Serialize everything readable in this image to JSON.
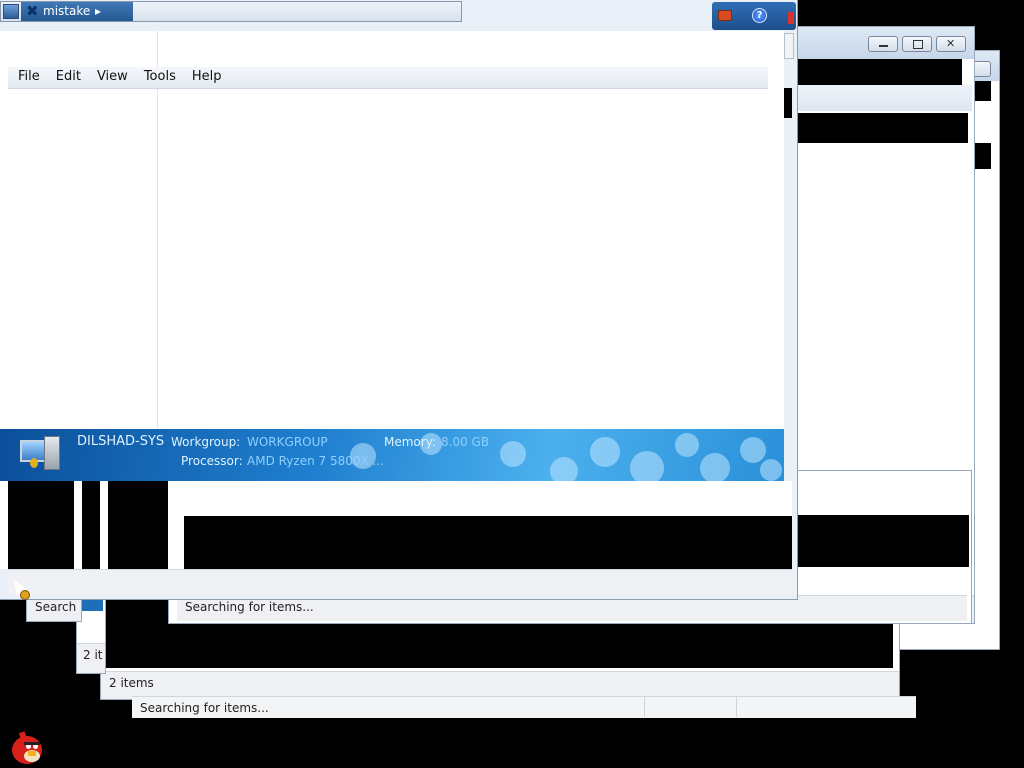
{
  "top_window": {
    "address_bar": {
      "app_icon": "control-panel-icon",
      "crumb_icon": "x-mark-icon",
      "crumb_label": "mistake",
      "chevron": "▸"
    },
    "menu": [
      "File",
      "Edit",
      "View",
      "Tools",
      "Help"
    ],
    "help_glyph": "?",
    "system_info": {
      "computer_name": "DILSHAD-SYS",
      "workgroup_label": "Workgroup:",
      "workgroup_value": "WORKGROUP",
      "memory_label": "Memory:",
      "memory_value": "8.00 GB",
      "processor_label": "Processor:",
      "processor_value": "AMD Ryzen 7 5800X ..."
    }
  },
  "background_windows": {
    "status_search_full": "Searching for items...",
    "status_search_cut": "Search",
    "status_items": "2 items",
    "status_items_cut": "2 it",
    "status_search_bottom": "Searching for items..."
  },
  "desktop": {
    "icon": "angry-bird-icon"
  },
  "colors": {
    "accent": "#1f7fcf",
    "banner_text": "#8fd0ff",
    "close_red": "#d9342b"
  }
}
